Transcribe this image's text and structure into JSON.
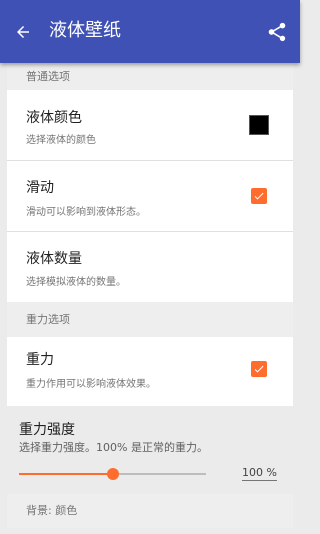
{
  "colors": {
    "app_bar": "#3f51b5",
    "accent": "#ff6d2e",
    "liquid_color": "#000000"
  },
  "app_bar": {
    "title": "液体壁纸",
    "back_icon": "arrow-back-icon",
    "share_icon": "share-icon"
  },
  "sections": {
    "general": "普通选项",
    "gravity": "重力选项",
    "background": "背景: 颜色"
  },
  "prefs": {
    "liquid_color": {
      "title": "液体颜色",
      "summary": "选择液体的颜色"
    },
    "swipe": {
      "title": "滑动",
      "summary": "滑动可以影响到液体形态。",
      "checked": true
    },
    "liquid_count": {
      "title": "液体数量",
      "summary": "选择模拟液体的数量。"
    },
    "gravity": {
      "title": "重力",
      "summary": "重力作用可以影响液体效果。",
      "checked": true
    },
    "gravity_strength": {
      "title": "重力强度",
      "summary": "选择重力强度。100% 是正常的重力。",
      "value_text": "100 %",
      "fraction": 0.5
    }
  }
}
